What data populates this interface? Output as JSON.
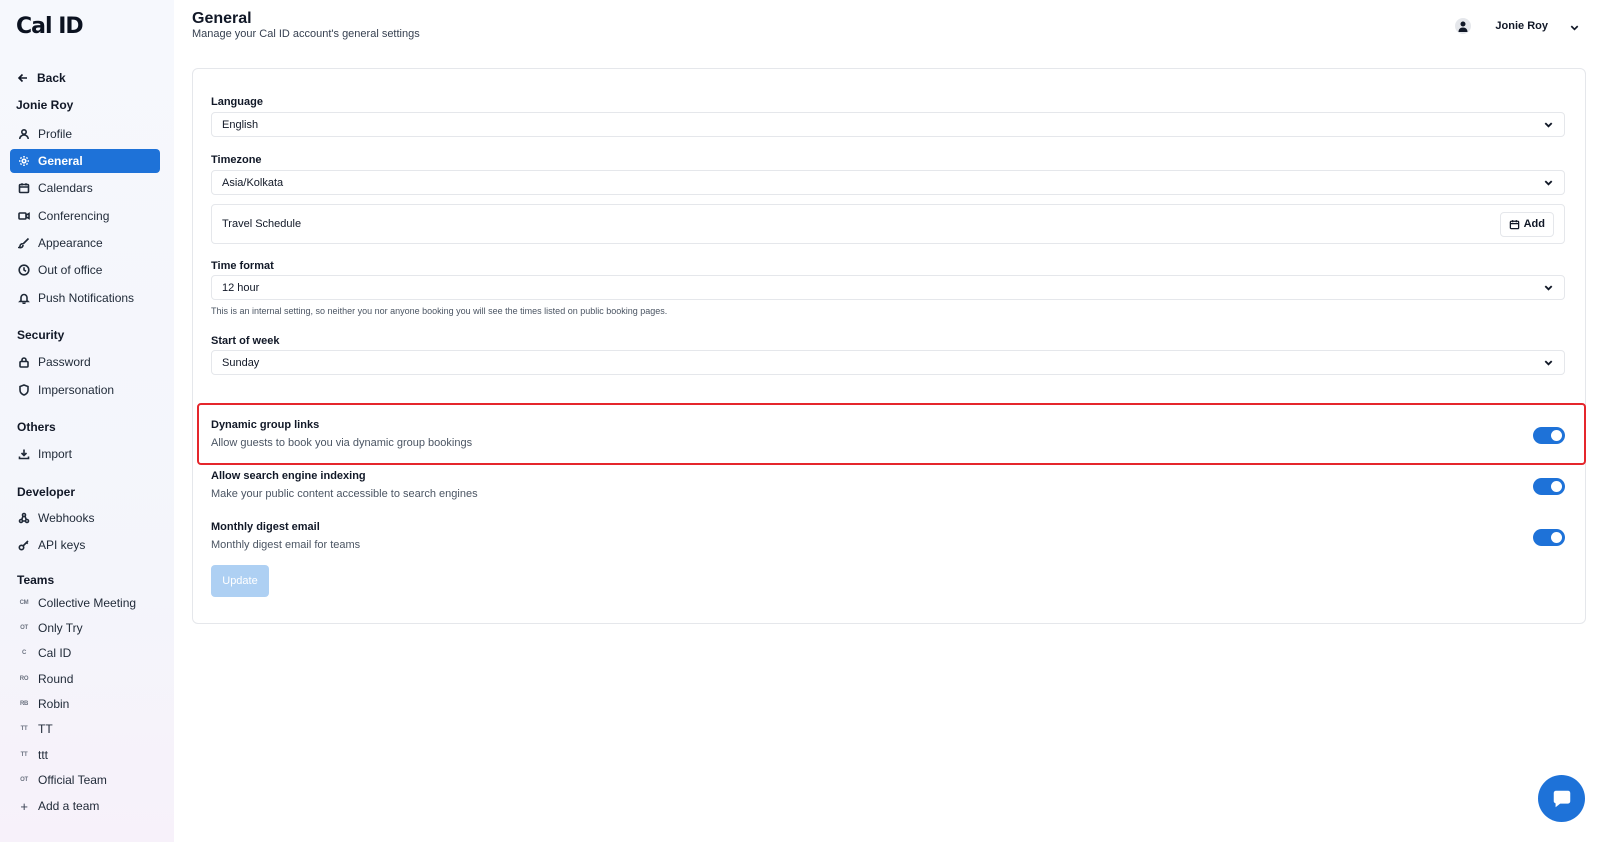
{
  "app": {
    "logo": "Cal ID"
  },
  "sidebar": {
    "back_label": "Back",
    "user_name": "Jonie Roy",
    "account_items": [
      {
        "label": "Profile",
        "icon": "user-icon",
        "active": false
      },
      {
        "label": "General",
        "icon": "gear-icon",
        "active": true
      },
      {
        "label": "Calendars",
        "icon": "calendar-icon",
        "active": false
      },
      {
        "label": "Conferencing",
        "icon": "video-icon",
        "active": false
      },
      {
        "label": "Appearance",
        "icon": "paintbrush-icon",
        "active": false
      },
      {
        "label": "Out of office",
        "icon": "clock-icon",
        "active": false
      },
      {
        "label": "Push Notifications",
        "icon": "bell-icon",
        "active": false
      }
    ],
    "security": {
      "title": "Security",
      "items": [
        {
          "label": "Password",
          "icon": "lock-icon"
        },
        {
          "label": "Impersonation",
          "icon": "shield-icon"
        }
      ]
    },
    "others": {
      "title": "Others",
      "items": [
        {
          "label": "Import",
          "icon": "download-icon"
        }
      ]
    },
    "developer": {
      "title": "Developer",
      "items": [
        {
          "label": "Webhooks",
          "icon": "webhook-icon"
        },
        {
          "label": "API keys",
          "icon": "key-icon"
        }
      ]
    },
    "teams": {
      "title": "Teams",
      "items": [
        {
          "label": "Collective Meeting",
          "badge": "CM"
        },
        {
          "label": "Only Try",
          "badge": "OT"
        },
        {
          "label": "Cal ID",
          "badge": "C"
        },
        {
          "label": "Round",
          "badge": "RO"
        },
        {
          "label": "Robin",
          "badge": "RB"
        },
        {
          "label": "TT",
          "badge": "TT"
        },
        {
          "label": "ttt",
          "badge": "TT"
        },
        {
          "label": "Official Team",
          "badge": "OT"
        }
      ],
      "add_label": "Add a team"
    }
  },
  "header": {
    "title": "General",
    "subtitle": "Manage your Cal ID account's general settings",
    "user_name": "Jonie Roy"
  },
  "form": {
    "language": {
      "label": "Language",
      "value": "English"
    },
    "timezone": {
      "label": "Timezone",
      "value": "Asia/Kolkata"
    },
    "travel_schedule": {
      "label": "Travel Schedule",
      "add_label": "Add"
    },
    "time_format": {
      "label": "Time format",
      "value": "12 hour",
      "hint": "This is an internal setting, so neither you nor anyone booking you will see the times listed on public booking pages."
    },
    "start_of_week": {
      "label": "Start of week",
      "value": "Sunday"
    },
    "toggles": [
      {
        "title": "Dynamic group links",
        "description": "Allow guests to book you via dynamic group bookings",
        "enabled": true
      },
      {
        "title": "Allow search engine indexing",
        "description": "Make your public content accessible to search engines",
        "enabled": true
      },
      {
        "title": "Monthly digest email",
        "description": "Monthly digest email for teams",
        "enabled": true
      }
    ],
    "update_label": "Update"
  },
  "colors": {
    "accent": "#1e72d8",
    "highlight": "#e5262c",
    "update_disabled": "#aed0f3"
  }
}
